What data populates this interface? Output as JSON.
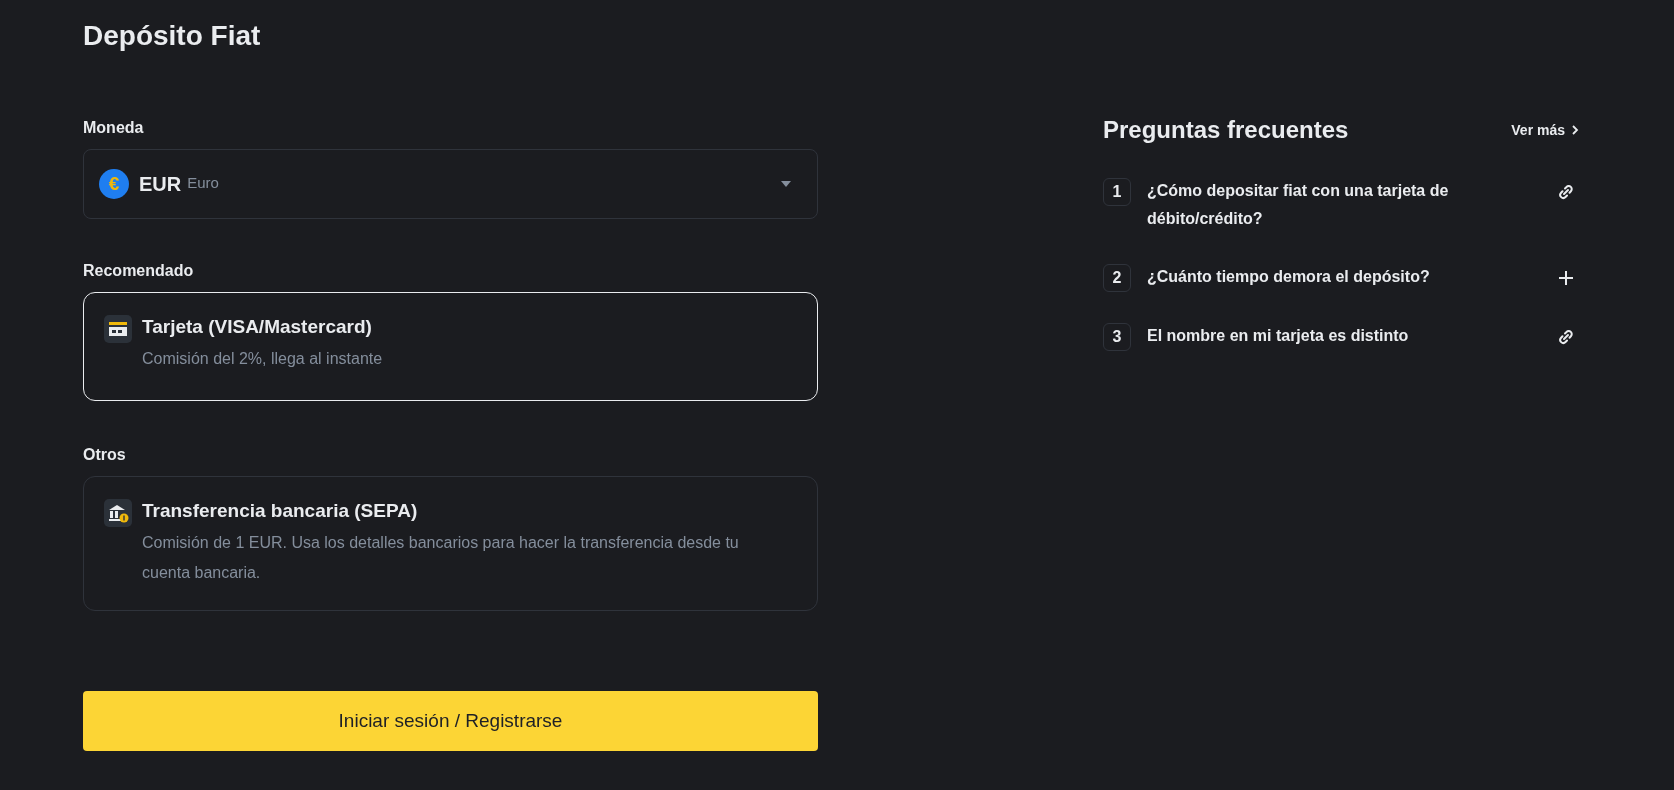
{
  "title": "Depósito Fiat",
  "currency": {
    "label": "Moneda",
    "code": "EUR",
    "name": "Euro",
    "symbol": "€"
  },
  "method_groups": [
    {
      "label": "Recomendado",
      "methods": [
        {
          "kind": "card",
          "title": "Tarjeta (VISA/Mastercard)",
          "description": "Comisión del 2%, llega al instante",
          "selected": true
        }
      ]
    },
    {
      "label": "Otros",
      "methods": [
        {
          "kind": "bank",
          "title": "Transferencia bancaria (SEPA)",
          "description": "Comisión de 1 EUR. Usa los detalles bancarios para hacer la transferencia desde tu cuenta bancaria.",
          "selected": false
        }
      ]
    }
  ],
  "login_button": "Iniciar sesión / Registrarse",
  "faq": {
    "title": "Preguntas frecuentes",
    "more_link": "Ver más",
    "items": [
      {
        "number": "1",
        "question": "¿Cómo depositar fiat con una tarjeta de débito/crédito?",
        "kind": "link"
      },
      {
        "number": "2",
        "question": "¿Cuánto tiempo demora el depósito?",
        "kind": "expand"
      },
      {
        "number": "3",
        "question": "El nombre en mi tarjeta es distinto",
        "kind": "link"
      }
    ]
  }
}
